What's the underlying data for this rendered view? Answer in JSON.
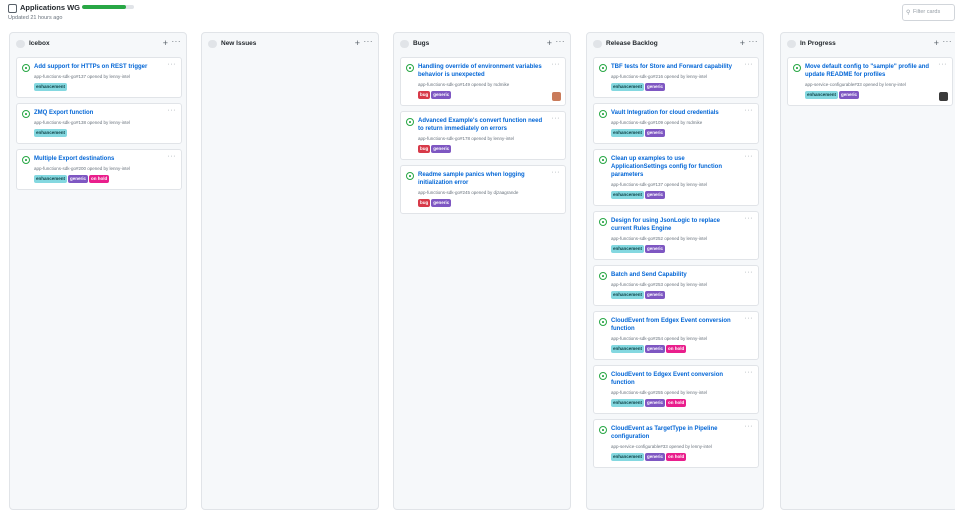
{
  "project": {
    "title": "Applications WG",
    "updated": "Updated 21 hours ago",
    "progress_percent": 85,
    "progress_color": "#28a745",
    "filter_placeholder": "Filter cards"
  },
  "label_colors": {
    "enhancement": "#84d8e0",
    "generic": "#7e57c2",
    "bug": "#d73a49",
    "on hold": "#e91e8c"
  },
  "columns": [
    {
      "name": "Icebox",
      "cards": [
        {
          "title": "Add support for HTTPs on REST trigger",
          "meta": "app-functions-sdk-go#137 opened by lenny-intel",
          "labels": [
            "enhancement"
          ],
          "avatar": ""
        },
        {
          "title": "ZMQ Export function",
          "meta": "app-functions-sdk-go#138 opened by lenny-intel",
          "labels": [
            "enhancement"
          ],
          "avatar": ""
        },
        {
          "title": "Multiple Export destinations",
          "meta": "app-functions-sdk-go#200 opened by lenny-intel",
          "labels": [
            "enhancement",
            "generic",
            "on hold"
          ],
          "avatar": ""
        }
      ]
    },
    {
      "name": "New Issues",
      "cards": []
    },
    {
      "name": "Bugs",
      "cards": [
        {
          "title": "Handling override of environment variables behavior is unexpected",
          "meta": "app-functions-sdk-go#149 opened by rsdmike",
          "labels": [
            "bug",
            "generic"
          ],
          "avatar": "#c97b5a"
        },
        {
          "title": "Advanced Example's convert function need to return immediately on errors",
          "meta": "app-functions-sdk-go#178 opened by lenny-intel",
          "labels": [
            "bug",
            "generic"
          ],
          "avatar": ""
        },
        {
          "title": "Readme sample panics when logging initialization error",
          "meta": "app-functions-sdk-go#245 opened by djzaagrande",
          "labels": [
            "bug",
            "generic"
          ],
          "avatar": ""
        }
      ]
    },
    {
      "name": "Release Backlog",
      "cards": [
        {
          "title": "TBF tests for Store and Forward capability",
          "meta": "app-functions-sdk-go#216 opened by lenny-intel",
          "labels": [
            "enhancement",
            "generic"
          ],
          "avatar": ""
        },
        {
          "title": "Vault Integration for cloud credentials",
          "meta": "app-functions-sdk-go#109 opened by rsdmike",
          "labels": [
            "enhancement",
            "generic"
          ],
          "avatar": ""
        },
        {
          "title": "Clean up examples to use ApplicationSettings config for function parameters",
          "meta": "app-functions-sdk-go#137 opened by lenny-intel",
          "labels": [
            "enhancement",
            "generic"
          ],
          "avatar": ""
        },
        {
          "title": "Design for using JsonLogic to replace current Rules Engine",
          "meta": "app-functions-sdk-go#252 opened by lenny-intel",
          "labels": [
            "enhancement",
            "generic"
          ],
          "avatar": ""
        },
        {
          "title": "Batch and Send Capability",
          "meta": "app-functions-sdk-go#253 opened by lenny-intel",
          "labels": [
            "enhancement",
            "generic"
          ],
          "avatar": ""
        },
        {
          "title": "CloudEvent from Edgex Event conversion function",
          "meta": "app-functions-sdk-go#254 opened by lenny-intel",
          "labels": [
            "enhancement",
            "generic",
            "on hold"
          ],
          "avatar": ""
        },
        {
          "title": "CloudEvent to Edgex Event conversion function",
          "meta": "app-functions-sdk-go#255 opened by lenny-intel",
          "labels": [
            "enhancement",
            "generic",
            "on hold"
          ],
          "avatar": ""
        },
        {
          "title": "CloudEvent as TargetType in Pipeline configuration",
          "meta": "app-service-configurable#33 opened by lenny-intel",
          "labels": [
            "enhancement",
            "generic",
            "on hold"
          ],
          "avatar": ""
        }
      ]
    },
    {
      "name": "In Progress",
      "cards": [
        {
          "title": "Move default config to \"sample\" profile and update README for profiles",
          "meta": "app-service-configurable#33 opened by lenny-intel",
          "labels": [
            "enhancement",
            "generic"
          ],
          "avatar": "#3a3a3a"
        }
      ]
    }
  ]
}
